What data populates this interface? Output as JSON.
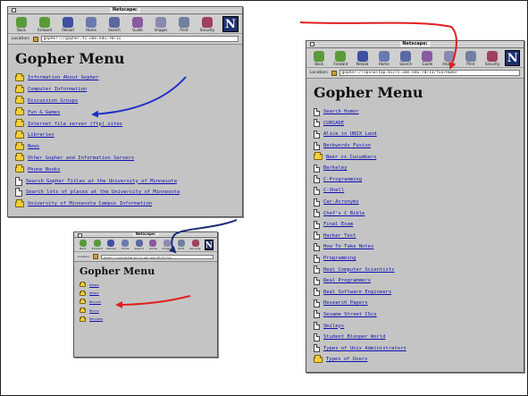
{
  "colors": {
    "red_arrow": "#e02020",
    "blue_arrow": "#2030c8",
    "navy_arrow": "#1a2a78",
    "link": "#1010b0",
    "folder": "#f1cf3a"
  },
  "toolbar_buttons": [
    {
      "label": "Back",
      "icon": "back-arrow-icon",
      "color": "#5a9a3a"
    },
    {
      "label": "Forward",
      "icon": "forward-arrow-icon",
      "color": "#5a9a3a"
    },
    {
      "label": "Reload",
      "icon": "reload-icon",
      "color": "#4050a0"
    },
    {
      "label": "Home",
      "icon": "home-icon",
      "color": "#6a7ab0"
    },
    {
      "label": "Search",
      "icon": "search-icon",
      "color": "#5a6aa0"
    },
    {
      "label": "Guide",
      "icon": "guide-icon",
      "color": "#8a5aa0"
    },
    {
      "label": "Images",
      "icon": "images-icon",
      "color": "#8a8ab0"
    },
    {
      "label": "Print",
      "icon": "print-icon",
      "color": "#7080a0"
    },
    {
      "label": "Security",
      "icon": "security-lock-icon",
      "color": "#a04060"
    }
  ],
  "window_a": {
    "title": "Netscape:",
    "location_label": "Location:",
    "location_url": "gopher://gopher.tc.umn.edu:70/11",
    "page_title": "Gopher Menu",
    "items": [
      {
        "type": "folder",
        "label": "Information About Gopher"
      },
      {
        "type": "folder",
        "label": "Computer Information"
      },
      {
        "type": "folder",
        "label": "Discussion Groups"
      },
      {
        "type": "folder",
        "label": "Fun & Games"
      },
      {
        "type": "folder",
        "label": "Internet file server (ftp) sites"
      },
      {
        "type": "folder",
        "label": "Libraries"
      },
      {
        "type": "folder",
        "label": "News"
      },
      {
        "type": "folder",
        "label": "Other Gopher and Information Servers"
      },
      {
        "type": "folder",
        "label": "Phone Books"
      },
      {
        "type": "doc",
        "label": "Search Gopher Titles at the University of Minnesota"
      },
      {
        "type": "doc",
        "label": "Search lots of places at the University of Minnesota"
      },
      {
        "type": "folder",
        "label": "University of Minnesota Campus Information"
      }
    ]
  },
  "window_b": {
    "title": "Netscape:",
    "location_label": "Location:",
    "location_url": "gopher://spinaltap.micro.umn.edu:70/11/fun/Humor",
    "page_title": "Gopher Menu",
    "items": [
      {
        "type": "doc",
        "label": "Search Humor"
      },
      {
        "type": "doc",
        "label": "CURSADE"
      },
      {
        "type": "doc",
        "label": "Alice in UNIX Land"
      },
      {
        "type": "doc",
        "label": "Beckwords Fusion"
      },
      {
        "type": "folder",
        "label": "Beer vs Cucumbers"
      },
      {
        "type": "doc",
        "label": "Berkeley"
      },
      {
        "type": "doc",
        "label": "C-Programming"
      },
      {
        "type": "doc",
        "label": "C-Shell"
      },
      {
        "type": "doc",
        "label": "Car-Acronyms"
      },
      {
        "type": "doc",
        "label": "Chef's C Bible"
      },
      {
        "type": "doc",
        "label": "Final Exam"
      },
      {
        "type": "doc",
        "label": "Hacker Test"
      },
      {
        "type": "doc",
        "label": "How To Take Notes"
      },
      {
        "type": "doc",
        "label": "Programming"
      },
      {
        "type": "doc",
        "label": "Real Computer Scientists"
      },
      {
        "type": "doc",
        "label": "Real Programmers"
      },
      {
        "type": "doc",
        "label": "Real Software Engineers"
      },
      {
        "type": "doc",
        "label": "Research Papers"
      },
      {
        "type": "doc",
        "label": "Sesame Street CScs"
      },
      {
        "type": "doc",
        "label": "Smileys"
      },
      {
        "type": "doc",
        "label": "Student Blooper World"
      },
      {
        "type": "doc",
        "label": "Types of Unix Administrators"
      },
      {
        "type": "folder",
        "label": "Types of Users"
      }
    ]
  },
  "window_c": {
    "title": "Netscape:",
    "location_label": "Location:",
    "location_url": "gopher://spinaltap.micro.umn.edu:70/11/fun",
    "page_title": "Gopher Menu",
    "items": [
      {
        "type": "folder",
        "label": "Games"
      },
      {
        "type": "folder",
        "label": "Humor"
      },
      {
        "type": "folder",
        "label": "Movies"
      },
      {
        "type": "folder",
        "label": "Music"
      },
      {
        "type": "folder",
        "label": "Recipes"
      }
    ]
  }
}
